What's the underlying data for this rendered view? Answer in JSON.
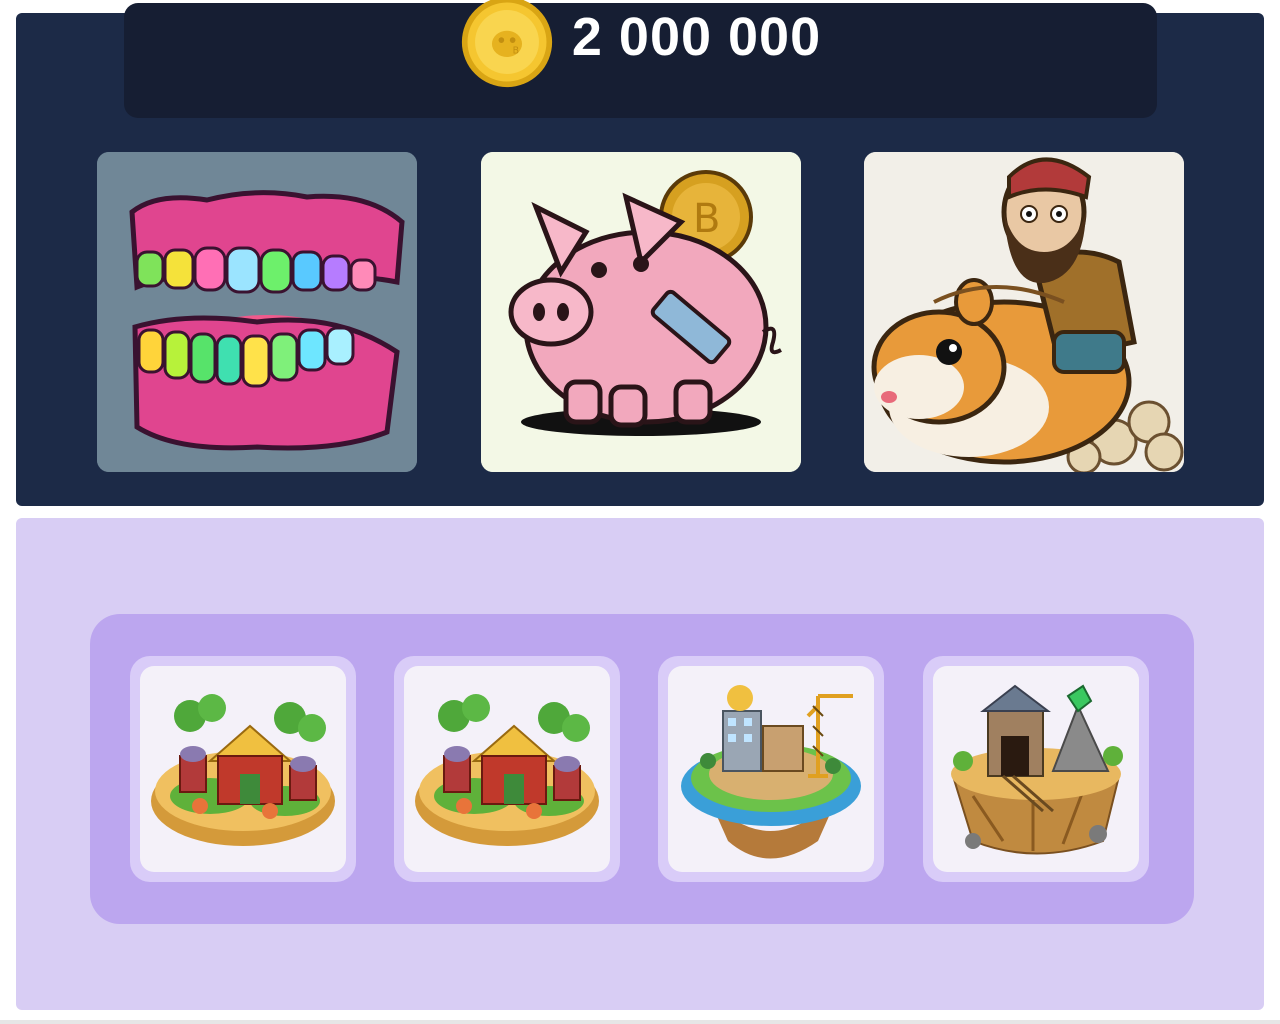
{
  "balance": {
    "amount": "2 000 000",
    "icon": "gold-coin-icon"
  },
  "featured_cards": [
    {
      "name": "rainbow-teeth",
      "icon": "rainbow-teeth-illustration"
    },
    {
      "name": "piggy-bank",
      "icon": "broken-piggy-bank-illustration"
    },
    {
      "name": "hamster-rider",
      "icon": "man-riding-hamster-illustration"
    }
  ],
  "islands": [
    {
      "name": "farm-island",
      "icon": "farm-island-illustration"
    },
    {
      "name": "farm-island",
      "icon": "farm-island-illustration"
    },
    {
      "name": "city-island",
      "icon": "construction-island-illustration"
    },
    {
      "name": "mine-island",
      "icon": "mine-island-illustration"
    }
  ],
  "colors": {
    "top_panel": "#1c2a47",
    "balance_card": "#161e33",
    "bottom_panel": "#d8cdf4",
    "tray": "#bca6ef",
    "coin": "#f2c12e"
  }
}
